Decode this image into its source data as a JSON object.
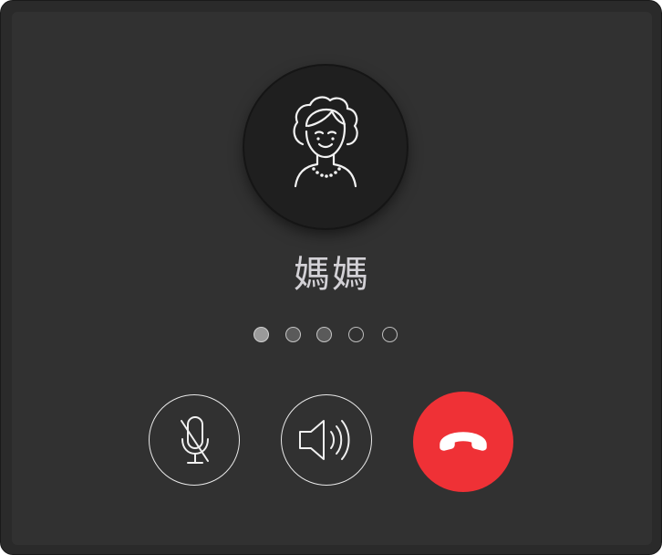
{
  "call": {
    "caller_name": "媽媽",
    "avatar_icon": "woman-avatar-icon",
    "status_dots": {
      "total": 5,
      "active_index": 1
    }
  },
  "controls": [
    {
      "name": "mute-button",
      "icon": "microphone-muted-icon"
    },
    {
      "name": "speaker-button",
      "icon": "speaker-icon"
    },
    {
      "name": "end-call-button",
      "icon": "phone-hangup-icon"
    }
  ],
  "colors": {
    "background": "#313131",
    "end_call": "#ef3136",
    "text": "#d3d1d6",
    "outline": "#e9e9e9"
  }
}
